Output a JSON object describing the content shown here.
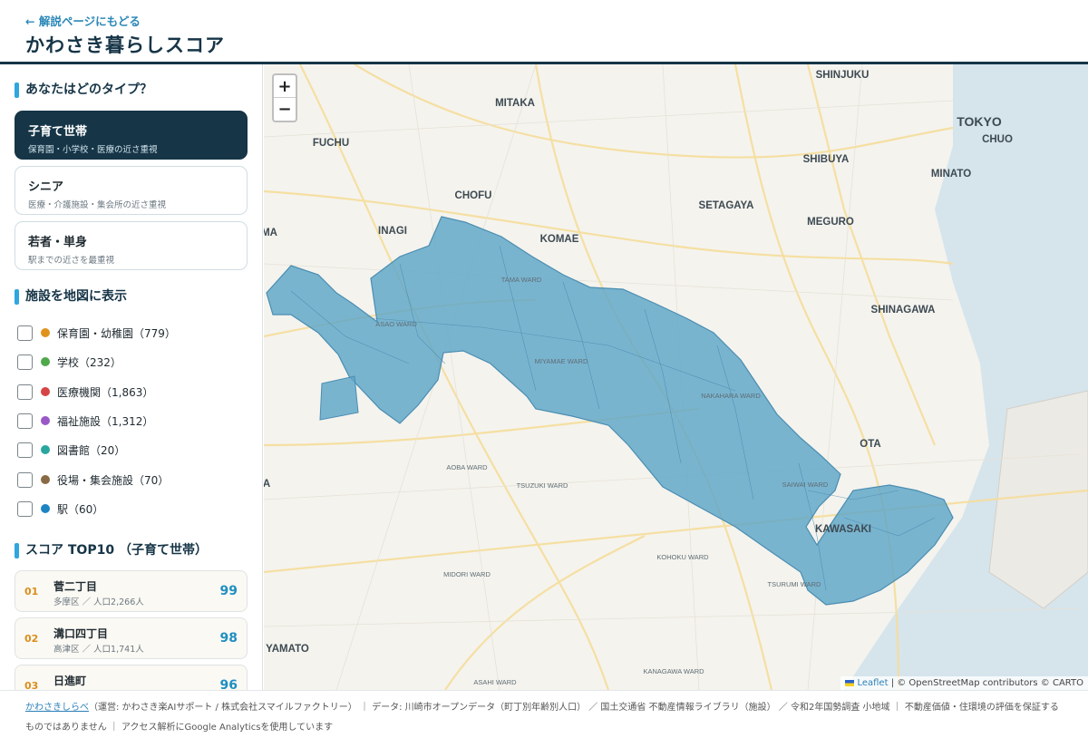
{
  "header": {
    "back_link": "← 解説ページにもどる",
    "title": "かわさき暮らしスコア"
  },
  "sidebar": {
    "type_section_title": "あなたはどのタイプ？",
    "types": [
      {
        "title": "子育て世帯",
        "desc": "保育園・小学校・医療の近さ重視",
        "active": true
      },
      {
        "title": "シニア",
        "desc": "医療・介護施設・集会所の近さ重視",
        "active": false
      },
      {
        "title": "若者・単身",
        "desc": "駅までの近さを最重視",
        "active": false
      }
    ],
    "facility_section_title": "施設を地図に表示",
    "facilities": [
      {
        "label": "保育園・幼稚園（779）",
        "color": "#e0931c",
        "checked": false
      },
      {
        "label": "学校（232）",
        "color": "#4fa84a",
        "checked": false
      },
      {
        "label": "医療機関（1,863）",
        "color": "#d64545",
        "checked": false
      },
      {
        "label": "福祉施設（1,312）",
        "color": "#9a58c7",
        "checked": false
      },
      {
        "label": "図書館（20）",
        "color": "#2aa6a0",
        "checked": false
      },
      {
        "label": "役場・集会施設（70）",
        "color": "#8a6a45",
        "checked": false
      },
      {
        "label": "駅（60）",
        "color": "#1d85c4",
        "checked": false
      }
    ],
    "ranking_section_title": "スコア TOP10 （子育て世帯）",
    "ranking": [
      {
        "no": "01",
        "name": "菅二丁目",
        "sub": "多摩区 ／ 人口2,266人",
        "score": "99"
      },
      {
        "no": "02",
        "name": "溝口四丁目",
        "sub": "高津区 ／ 人口1,741人",
        "score": "98"
      },
      {
        "no": "03",
        "name": "日進町",
        "sub": "",
        "score": "96"
      }
    ]
  },
  "map": {
    "zoom_in": "+",
    "zoom_out": "−",
    "labels_major": [
      "SHINJUKU",
      "MITAKA",
      "FUCHU",
      "CHOFU",
      "INAGI",
      "KOMAE",
      "SETAGAYA",
      "MEGURO",
      "SHIBUYA",
      "MINATO",
      "CHUO",
      "TOKYO",
      "SHINAGAWA",
      "OTA",
      "KAWASAKI",
      "YAMATO",
      "MA",
      "A"
    ],
    "labels_ward": [
      "TAMA WARD",
      "ASAO WARD",
      "MIYAMAE WARD",
      "NAKAHARA WARD",
      "SAIWAI WARD",
      "AOBA WARD",
      "TSUZUKI WARD",
      "KOHOKU WARD",
      "MIDORI WARD",
      "TSURUMI WARD",
      "ASAHI WARD",
      "KANAGAWA WARD"
    ],
    "attribution_leaflet": "Leaflet",
    "attribution_rest": " | © OpenStreetMap contributors © CARTO"
  },
  "footer": {
    "brand": "かわさきしらべ",
    "text": "（運営: かわさき楽AIサポート / 株式会社スマイルファクトリー） ｜ データ: 川崎市オープンデータ（町丁別年齢別人口） ／ 国土交通省 不動産情報ライブラリ（施設） ／ 令和2年国勢調査 小地域 ｜ 不動産価値・住環境の評価を保証するものではありません ｜ アクセス解析にGoogle Analyticsを使用しています"
  },
  "colors": {
    "navy": "#163547",
    "accent": "#2ea7de",
    "score": "#1f8fc2",
    "region": "#5ba8cc"
  }
}
